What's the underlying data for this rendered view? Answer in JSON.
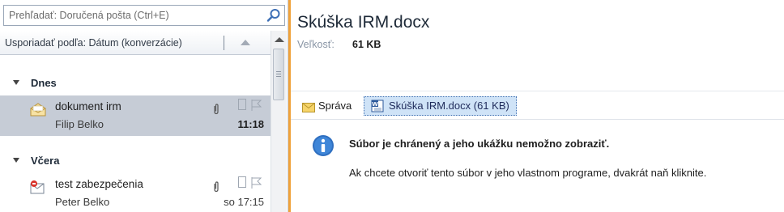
{
  "search": {
    "placeholder": "Prehľadať: Doručená pošta (Ctrl+E)"
  },
  "arrange": {
    "label": "Usporiadať podľa: Dátum (konverzácie)"
  },
  "groups": [
    {
      "label": "Dnes"
    },
    {
      "label": "Včera"
    }
  ],
  "messages": [
    {
      "subject": "dokument irm",
      "from": "Filip Belko",
      "time": "11:18",
      "selected": true
    },
    {
      "subject": "test zabezpečenia",
      "from": "Peter Belko",
      "time": "so 17:15",
      "selected": false
    }
  ],
  "reading": {
    "title": "Skúška IRM.docx",
    "size_label": "Veľkosť:",
    "size_value": "61 KB",
    "tab_message": "Správa",
    "tab_attachment": "Skúška IRM.docx (61 KB)",
    "info_bold": "Súbor je chránený a jeho ukážku nemožno zobraziť.",
    "info_text": "Ak chcete otvoriť tento súbor v jeho vlastnom programe, dvakrát naň kliknite."
  },
  "colors": {
    "selection": "#c6ccd6",
    "splitter": "#f0a23a",
    "attachment_tab": "#cfe3f7",
    "info_icon": "#2f6fc0"
  }
}
